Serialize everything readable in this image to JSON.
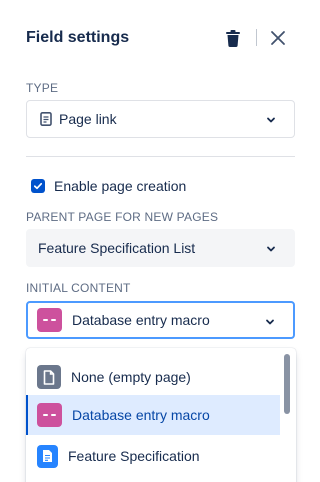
{
  "header": {
    "title": "Field settings",
    "delete_icon": "trash-icon",
    "close_icon": "close-icon"
  },
  "type_field": {
    "label": "TYPE",
    "value": "Page link",
    "icon": "document-icon"
  },
  "enable_page_creation": {
    "label": "Enable page creation",
    "checked": true
  },
  "parent_page": {
    "label": "PARENT PAGE FOR NEW PAGES",
    "value": "Feature Specification List"
  },
  "initial_content": {
    "label": "INITIAL CONTENT",
    "value": "Database entry macro",
    "icon": "database-macro-icon"
  },
  "dropdown": {
    "options": [
      {
        "label": "None (empty page)",
        "icon": "blank-page-icon",
        "selected": false
      },
      {
        "label": "Database entry macro",
        "icon": "database-macro-icon",
        "selected": true
      },
      {
        "label": "Feature Specification",
        "icon": "template-page-icon",
        "selected": false
      }
    ]
  },
  "colors": {
    "accent": "#0052cc",
    "focus_border": "#4c9aff",
    "macro": "#cd519d",
    "selected_bg": "#deebff",
    "text": "#172b4d",
    "muted": "#5e6c84"
  }
}
